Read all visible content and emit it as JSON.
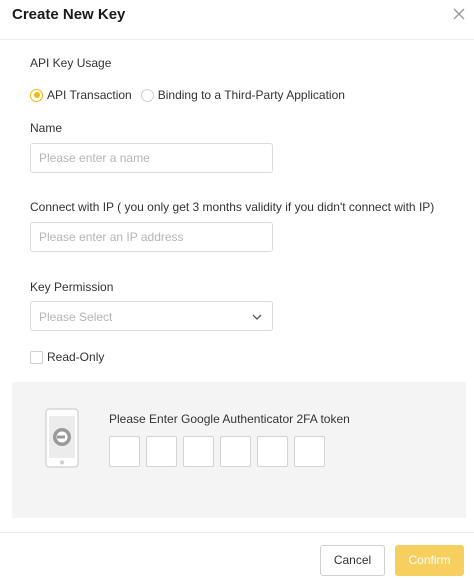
{
  "dialog": {
    "title": "Create New Key",
    "close_icon": "close-icon"
  },
  "usage": {
    "label": "API Key Usage",
    "options": [
      {
        "label": "API Transaction",
        "selected": true
      },
      {
        "label": "Binding to a Third-Party Application",
        "selected": false
      }
    ]
  },
  "name_field": {
    "label": "Name",
    "placeholder": "Please enter a name",
    "value": ""
  },
  "ip_field": {
    "label": "Connect with IP ( you only get 3 months validity if you didn't connect with IP)",
    "placeholder": "Please enter an IP address",
    "value": ""
  },
  "permission": {
    "label": "Key Permission",
    "placeholder": "Please Select",
    "chevron_icon": "chevron-down-icon"
  },
  "read_only": {
    "label": "Read-Only",
    "checked": false
  },
  "twofa": {
    "label": "Please Enter Google Authenticator 2FA token",
    "icon": "phone-icon",
    "digits": [
      "",
      "",
      "",
      "",
      "",
      ""
    ]
  },
  "footer": {
    "cancel_label": "Cancel",
    "confirm_label": "Confirm"
  },
  "colors": {
    "accent": "#f0b90b",
    "confirm_bg": "#f6cf5e",
    "panel_bg": "#f4f4f4"
  }
}
